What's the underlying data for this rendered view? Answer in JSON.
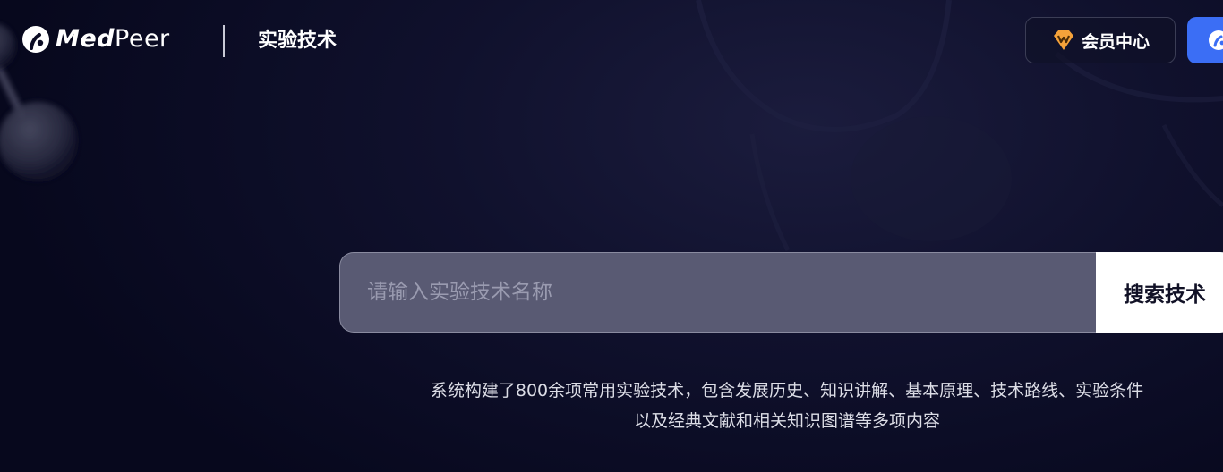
{
  "header": {
    "logo": {
      "text_bold": "Med",
      "text_light": "Peer"
    },
    "section_title": "实验技术",
    "member_button": {
      "label": "会员中心",
      "icon": "m-badge-icon"
    },
    "login_button": {
      "icon": "user-icon"
    }
  },
  "search": {
    "placeholder": "请输入实验技术名称",
    "value": "",
    "button_label": "搜索技术"
  },
  "description": {
    "line1": "系统构建了800余项常用实验技术，包含发展历史、知识讲解、基本原理、技术路线、实验条件",
    "line2": "以及经典文献和相关知识图谱等多项内容"
  },
  "colors": {
    "background": "#0b0c24",
    "accent_blue": "#3b6ef5",
    "member_icon": "#f5a23a",
    "input_bg": "#595a73"
  }
}
